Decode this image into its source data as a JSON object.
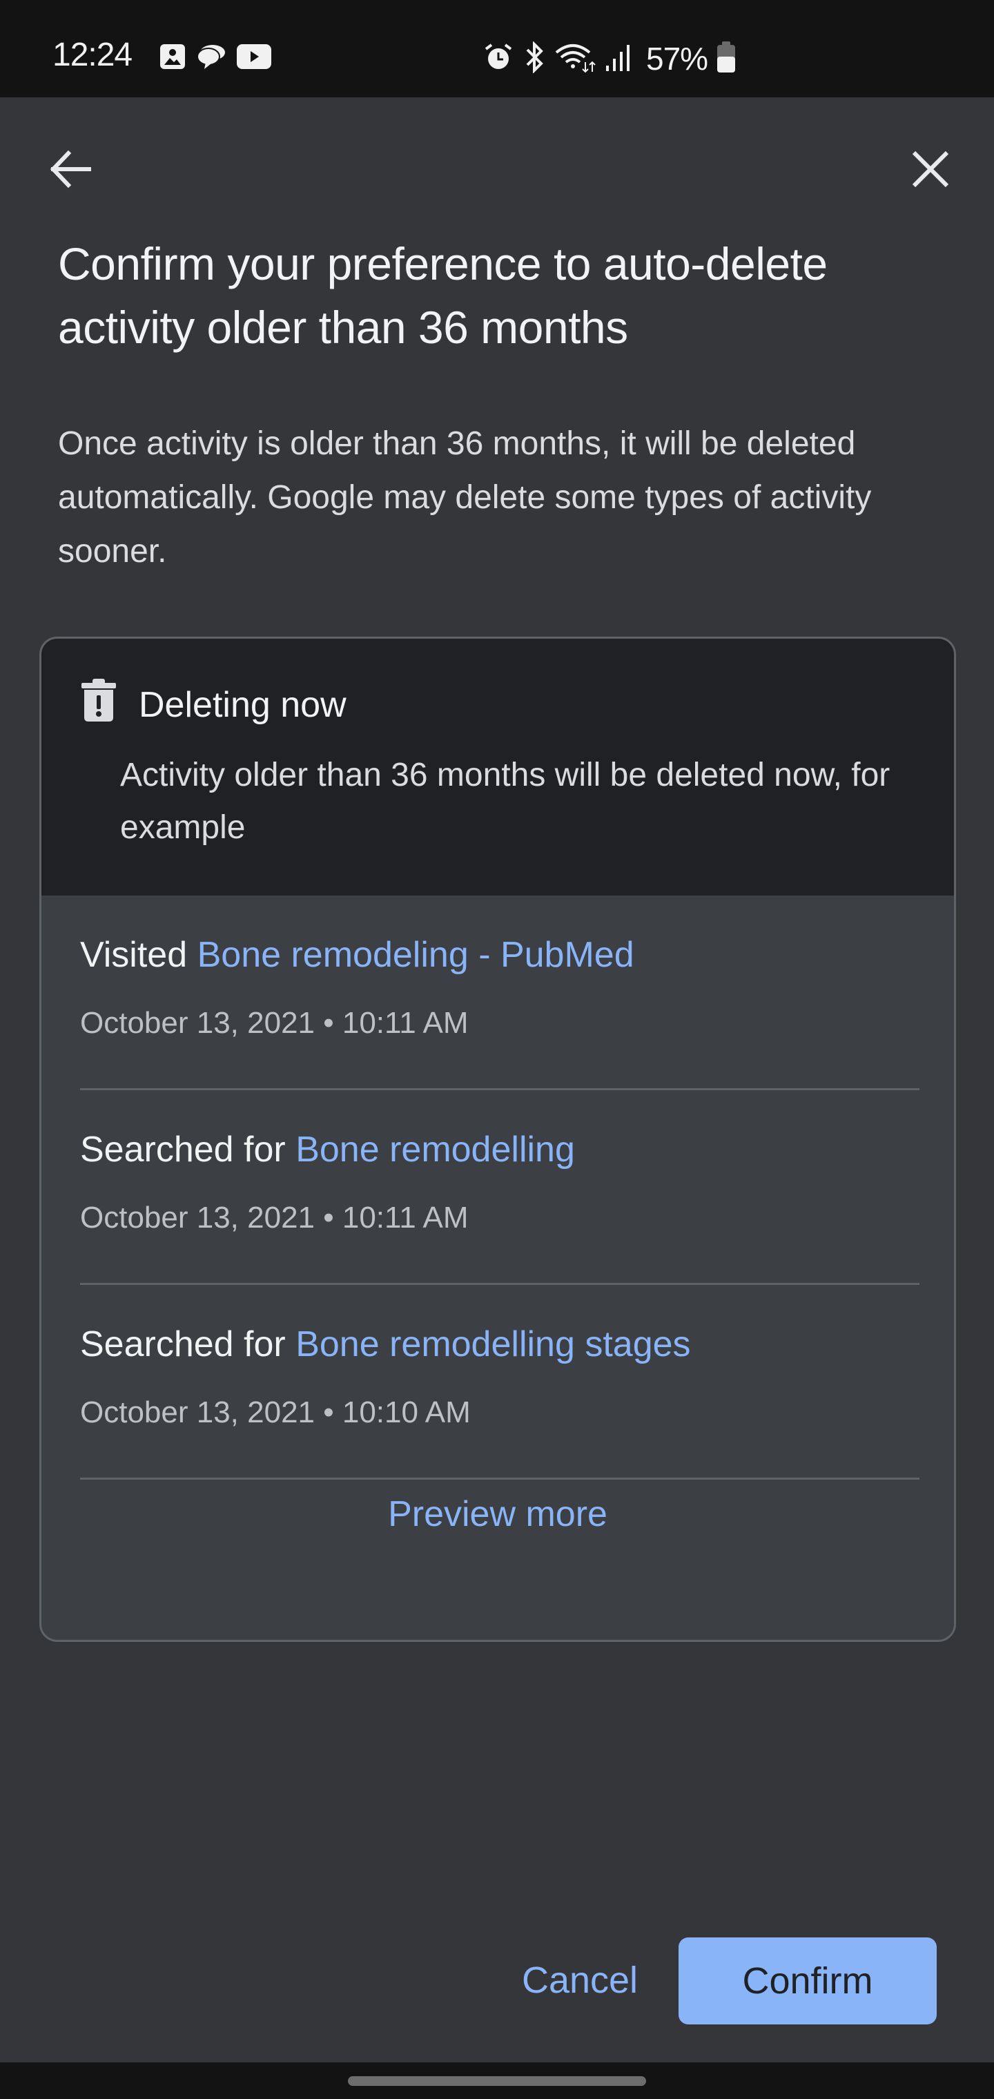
{
  "status_bar": {
    "time": "12:24",
    "left_icons": [
      "gallery-icon",
      "chat-icon",
      "youtube-icon"
    ],
    "right_icons": [
      "alarm-icon",
      "bluetooth-icon",
      "wifi-icon",
      "signal-icon"
    ],
    "battery_percent": "57%",
    "battery_level": 0.57
  },
  "header": {
    "back_icon": "arrow-back-icon",
    "close_icon": "close-icon"
  },
  "page": {
    "title": "Confirm your preference to auto-delete activity older than 36 months",
    "description": "Once activity is older than 36 months, it will be deleted automatically. Google may delete some types of activity sooner."
  },
  "card": {
    "icon": "trash-alert-icon",
    "heading": "Deleting now",
    "text": "Activity older than 36 months will be deleted now, for example",
    "items": [
      {
        "action": "Visited",
        "link": "Bone remodeling - PubMed",
        "meta": "October 13, 2021 • 10:11 AM"
      },
      {
        "action": "Searched for",
        "link": "Bone remodelling",
        "meta": "October 13, 2021 • 10:11 AM"
      },
      {
        "action": "Searched for",
        "link": "Bone remodelling stages",
        "meta": "October 13, 2021 • 10:10 AM"
      }
    ],
    "preview_more": "Preview more"
  },
  "actions": {
    "cancel": "Cancel",
    "confirm": "Confirm"
  },
  "colors": {
    "accent": "#8ab4f8",
    "background": "#35363a",
    "card_header": "#202124",
    "card_body": "#3c3f43"
  }
}
